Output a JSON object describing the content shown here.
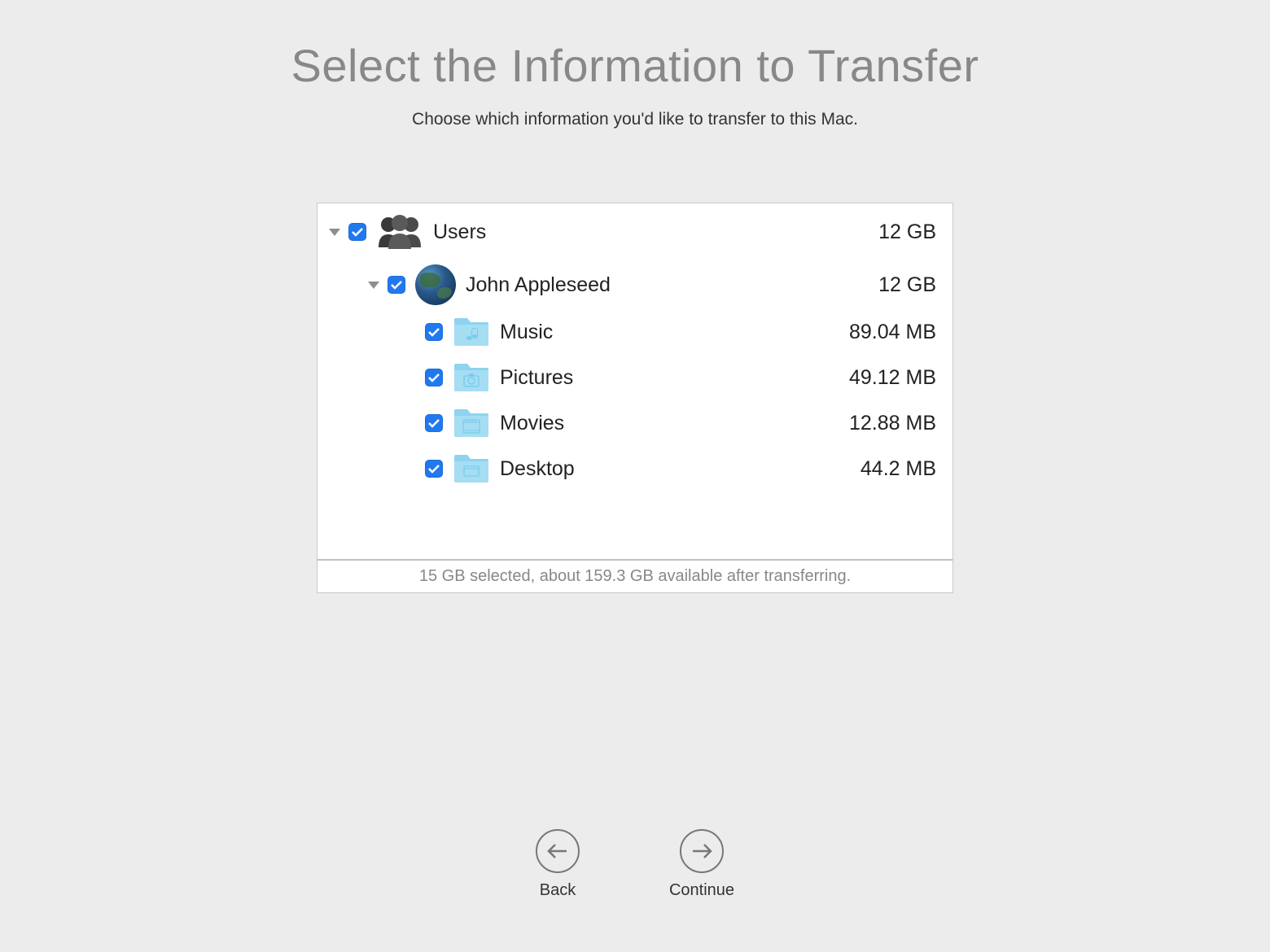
{
  "title": "Select the Information to Transfer",
  "subtitle": "Choose which information you'd like to transfer to this Mac.",
  "tree": {
    "users": {
      "label": "Users",
      "size": "12 GB",
      "expanded": true,
      "checked": true,
      "children": [
        {
          "label": "John Appleseed",
          "size": "12 GB",
          "expanded": true,
          "checked": true,
          "icon": "earth",
          "folders": [
            {
              "label": "Music",
              "size": "89.04 MB",
              "checked": true,
              "icon": "music"
            },
            {
              "label": "Pictures",
              "size": "49.12 MB",
              "checked": true,
              "icon": "pictures"
            },
            {
              "label": "Movies",
              "size": "12.88 MB",
              "checked": true,
              "icon": "movies"
            },
            {
              "label": "Desktop",
              "size": "44.2 MB",
              "checked": true,
              "icon": "desktop"
            }
          ]
        }
      ]
    }
  },
  "footer_status": "15 GB selected, about 159.3 GB available after transferring.",
  "nav": {
    "back_label": "Back",
    "continue_label": "Continue"
  }
}
